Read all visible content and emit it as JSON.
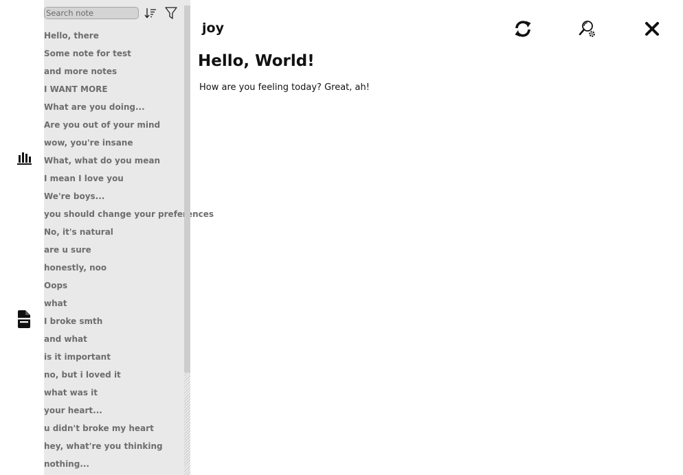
{
  "rail": {
    "items": [
      {
        "icon": "bar-chart-icon"
      },
      {
        "icon": "file-note-icon"
      }
    ]
  },
  "sidebar": {
    "search": {
      "placeholder": "Search note",
      "value": ""
    },
    "sort_icon": "sort-descending-icon",
    "filter_icon": "filter-icon",
    "notes": [
      "Hello, there",
      "Some note for test",
      "and more notes",
      "I WANT MORE",
      "What are you doing...",
      "Are you out of your mind",
      "wow, you're insane",
      "What, what do you mean",
      "I mean I love you",
      "We're boys...",
      "you should change your preferences",
      "No, it's natural",
      "are u sure",
      "honestly, noo",
      "Oops",
      "what",
      "I broke smth",
      "and what",
      "is it important",
      "no, but i loved it",
      "what was it",
      "your heart...",
      "u didn't broke my heart",
      "hey, what're you thinking",
      "nothing..."
    ]
  },
  "editor": {
    "title": "joy",
    "heading": "Hello, World!",
    "body": "How are you feeling today? Great, ah!",
    "toolbar": {
      "sync_icon": "sync-icon",
      "search_settings_icon": "search-settings-icon",
      "close_icon": "close-icon"
    }
  },
  "colors": {
    "sidebar_bg": "#e9e9e9",
    "note_text": "#6d6d6d",
    "search_bg": "#d4d4d4",
    "text": "#111111"
  }
}
